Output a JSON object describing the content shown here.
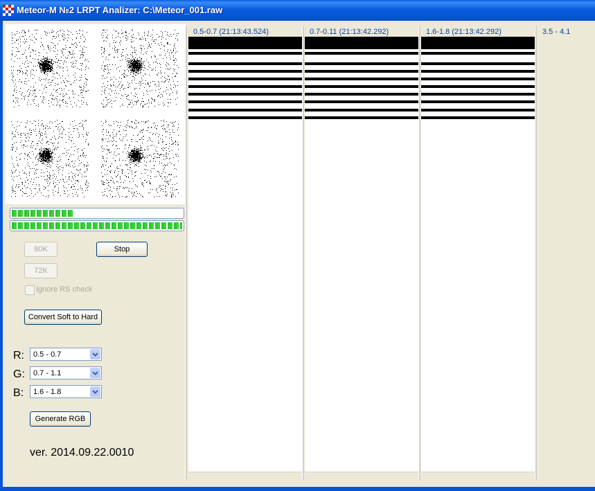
{
  "window": {
    "title": "Meteor-M №2 LRPT Analizer: C:\\Meteor_001.raw"
  },
  "colors": {
    "titlebar": "#0554d6",
    "progress": "#27c027",
    "channel_label": "#1040a0"
  },
  "progress": {
    "bar1_fraction": 0.36,
    "bar2_fraction": 1.0
  },
  "buttons": {
    "b80k": "80K",
    "stop": "Stop",
    "b72k": "72K",
    "convert": "Convert Soft to Hard",
    "generate": "Generate RGB"
  },
  "ignore_rs": {
    "label": "Ignore RS check",
    "checked": false
  },
  "rgb": {
    "r_label": "R:",
    "r_value": "0.5 - 0.7",
    "g_label": "G:",
    "g_value": "0.7 - 1.1",
    "b_label": "B:",
    "b_value": "1.6 - 1.8"
  },
  "version": "ver. 2014.09.22.0010",
  "channels": [
    {
      "label": "0.5-0.7 (21:13:43.524)"
    },
    {
      "label": "0.7-0.11 (21:13:42.292)"
    },
    {
      "label": "1.6-1.8 (21:13:42.292)"
    },
    {
      "label": "3.5 - 4.1"
    }
  ]
}
